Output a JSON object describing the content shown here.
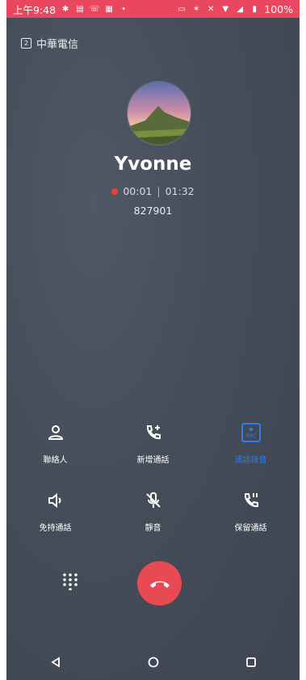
{
  "status_bar": {
    "time": "上午9:48",
    "battery": "100%",
    "icons": [
      "gear-icon",
      "calendar-icon",
      "phone-icon",
      "calendar-31-icon",
      "dot-icon",
      "nfc-icon",
      "bluetooth-icon",
      "mute-icon",
      "wifi-icon",
      "signal-icon",
      "battery-icon"
    ]
  },
  "sim": {
    "index": "2",
    "carrier": "中華電信"
  },
  "contact": {
    "name": "Yvonne",
    "elapsed": "00:01",
    "duration": "01:32",
    "number": "827901"
  },
  "actions_row1": [
    {
      "label": "聯絡人",
      "icon": "contact-icon"
    },
    {
      "label": "新增通話",
      "icon": "add-call-icon"
    },
    {
      "label": "通話錄音",
      "icon": "rec-icon",
      "active": true
    }
  ],
  "actions_row2": [
    {
      "label": "免持通話",
      "icon": "speaker-icon"
    },
    {
      "label": "靜音",
      "icon": "mic-off-icon"
    },
    {
      "label": "保留通話",
      "icon": "hold-icon"
    }
  ],
  "colors": {
    "status_bar": "#e8475f",
    "end_call": "#e74a53",
    "rec_active": "#2f7de1",
    "rec_dot": "#ff3b30"
  },
  "nav": [
    "back-icon",
    "home-icon",
    "recents-icon"
  ]
}
